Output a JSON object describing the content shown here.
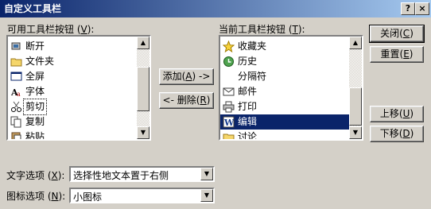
{
  "window": {
    "title": "自定义工具栏",
    "help_btn": "?",
    "close_btn": "×"
  },
  "available": {
    "label_prefix": "可用工具栏按钮 (",
    "label_key": "V",
    "label_suffix": "):",
    "items": [
      {
        "label": "断开",
        "icon": "disconnect-icon"
      },
      {
        "label": "文件夹",
        "icon": "folder-icon"
      },
      {
        "label": "全屏",
        "icon": "fullscreen-icon"
      },
      {
        "label": "字体",
        "icon": "font-icon"
      },
      {
        "label": "剪切",
        "icon": "scissors-icon"
      },
      {
        "label": "复制",
        "icon": "copy-icon"
      },
      {
        "label": "粘贴",
        "icon": "paste-icon"
      }
    ],
    "focused_item": "剪切"
  },
  "current": {
    "label_prefix": "当前工具栏按钮 (",
    "label_key": "T",
    "label_suffix": "):",
    "items": [
      {
        "label": "收藏夹",
        "icon": "star-icon"
      },
      {
        "label": "历史",
        "icon": "history-icon"
      },
      {
        "label": "分隔符",
        "icon": ""
      },
      {
        "label": "邮件",
        "icon": "mail-icon"
      },
      {
        "label": "打印",
        "icon": "printer-icon"
      },
      {
        "label": "编辑",
        "icon": "edit-icon"
      },
      {
        "label": "讨论",
        "icon": "discuss-icon"
      }
    ],
    "selected_item": "编辑"
  },
  "buttons": {
    "add_prefix": "添加(",
    "add_key": "A",
    "add_suffix": ") ->",
    "remove_prefix": "<- 删除(",
    "remove_key": "R",
    "remove_suffix": ")",
    "close_prefix": "关闭(",
    "close_key": "C",
    "close_suffix": ")",
    "reset_prefix": "重置(",
    "reset_key": "E",
    "reset_suffix": ")",
    "up_prefix": "上移(",
    "up_key": "U",
    "up_suffix": ")",
    "down_prefix": "下移(",
    "down_key": "D",
    "down_suffix": ")"
  },
  "text_options": {
    "label_prefix": "文字选项 (",
    "label_key": "X",
    "label_suffix": "):",
    "value": "选择性地文本置于右侧"
  },
  "icon_options": {
    "label_prefix": "图标选项 (",
    "label_key": "N",
    "label_suffix": "):",
    "value": "小图标"
  }
}
